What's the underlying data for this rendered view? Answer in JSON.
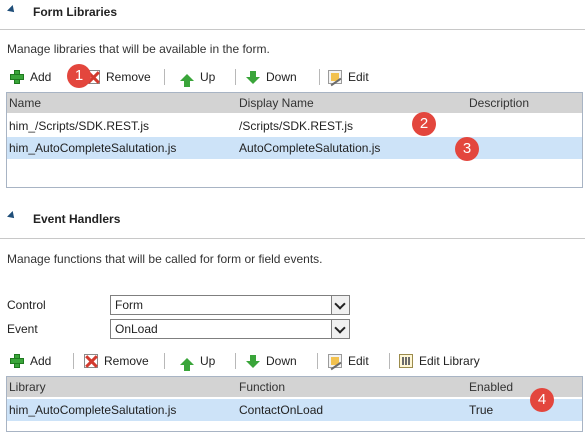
{
  "form_libraries": {
    "title": "Form Libraries",
    "description": "Manage libraries that will be available in the form.",
    "toolbar": {
      "add": "Add",
      "remove": "Remove",
      "up": "Up",
      "down": "Down",
      "edit": "Edit"
    },
    "columns": [
      "Name",
      "Display Name",
      "Description"
    ],
    "rows": [
      {
        "name": "him_/Scripts/SDK.REST.js",
        "display_name": "/Scripts/SDK.REST.js",
        "description": ""
      },
      {
        "name": "him_AutoCompleteSalutation.js",
        "display_name": "AutoCompleteSalutation.js",
        "description": ""
      }
    ]
  },
  "event_handlers": {
    "title": "Event Handlers",
    "description": "Manage functions that will be called for form or field events.",
    "control_label": "Control",
    "control_value": "Form",
    "event_label": "Event",
    "event_value": "OnLoad",
    "toolbar": {
      "add": "Add",
      "remove": "Remove",
      "up": "Up",
      "down": "Down",
      "edit": "Edit",
      "edit_library": "Edit Library"
    },
    "columns": [
      "Library",
      "Function",
      "Enabled"
    ],
    "rows": [
      {
        "library": "him_AutoCompleteSalutation.js",
        "function": "ContactOnLoad",
        "enabled": "True"
      }
    ]
  },
  "callouts": [
    "1",
    "2",
    "3",
    "4"
  ],
  "colors": {
    "selected_row": "#cde3f8",
    "header_row": "#d3d3d3",
    "callout": "#e3463d",
    "icon_green": "#3aa53a"
  }
}
